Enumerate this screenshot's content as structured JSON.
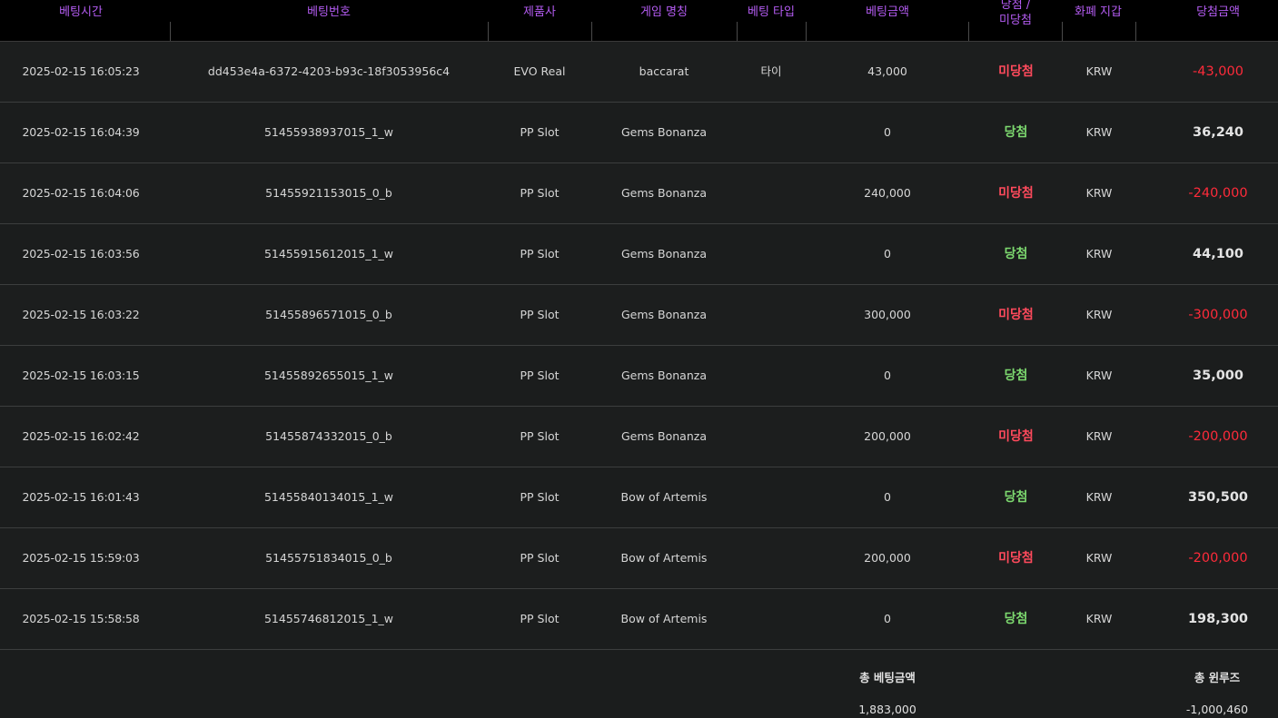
{
  "columns": [
    {
      "key": "time",
      "label": "베팅시간"
    },
    {
      "key": "bet_id",
      "label": "베팅번호"
    },
    {
      "key": "provider",
      "label": "제품사"
    },
    {
      "key": "game",
      "label": "게임 명칭"
    },
    {
      "key": "bet_type",
      "label": "베팅 타입"
    },
    {
      "key": "bet_amount",
      "label": "베팅금액"
    },
    {
      "key": "result",
      "label": "당첨 /\n미당첨"
    },
    {
      "key": "currency",
      "label": "화폐 지갑"
    },
    {
      "key": "win_amount",
      "label": "당첨금액"
    }
  ],
  "rows": [
    {
      "time": "2025-02-15 16:05:23",
      "bet_id": "dd453e4a-6372-4203-b93c-18f3053956c4",
      "provider": "EVO Real",
      "game": "baccarat",
      "bet_type": "타이",
      "bet_amount": "43,000",
      "result": "미당첨",
      "currency": "KRW",
      "win_amount": "-43,000",
      "status": "lose"
    },
    {
      "time": "2025-02-15 16:04:39",
      "bet_id": "51455938937015_1_w",
      "provider": "PP Slot",
      "game": "Gems Bonanza",
      "bet_type": "",
      "bet_amount": "0",
      "result": "당첨",
      "currency": "KRW",
      "win_amount": "36,240",
      "status": "win"
    },
    {
      "time": "2025-02-15 16:04:06",
      "bet_id": "51455921153015_0_b",
      "provider": "PP Slot",
      "game": "Gems Bonanza",
      "bet_type": "",
      "bet_amount": "240,000",
      "result": "미당첨",
      "currency": "KRW",
      "win_amount": "-240,000",
      "status": "lose"
    },
    {
      "time": "2025-02-15 16:03:56",
      "bet_id": "51455915612015_1_w",
      "provider": "PP Slot",
      "game": "Gems Bonanza",
      "bet_type": "",
      "bet_amount": "0",
      "result": "당첨",
      "currency": "KRW",
      "win_amount": "44,100",
      "status": "win"
    },
    {
      "time": "2025-02-15 16:03:22",
      "bet_id": "51455896571015_0_b",
      "provider": "PP Slot",
      "game": "Gems Bonanza",
      "bet_type": "",
      "bet_amount": "300,000",
      "result": "미당첨",
      "currency": "KRW",
      "win_amount": "-300,000",
      "status": "lose"
    },
    {
      "time": "2025-02-15 16:03:15",
      "bet_id": "51455892655015_1_w",
      "provider": "PP Slot",
      "game": "Gems Bonanza",
      "bet_type": "",
      "bet_amount": "0",
      "result": "당첨",
      "currency": "KRW",
      "win_amount": "35,000",
      "status": "win"
    },
    {
      "time": "2025-02-15 16:02:42",
      "bet_id": "51455874332015_0_b",
      "provider": "PP Slot",
      "game": "Gems Bonanza",
      "bet_type": "",
      "bet_amount": "200,000",
      "result": "미당첨",
      "currency": "KRW",
      "win_amount": "-200,000",
      "status": "lose"
    },
    {
      "time": "2025-02-15 16:01:43",
      "bet_id": "51455840134015_1_w",
      "provider": "PP Slot",
      "game": "Bow of Artemis",
      "bet_type": "",
      "bet_amount": "0",
      "result": "당첨",
      "currency": "KRW",
      "win_amount": "350,500",
      "status": "win"
    },
    {
      "time": "2025-02-15 15:59:03",
      "bet_id": "51455751834015_0_b",
      "provider": "PP Slot",
      "game": "Bow of Artemis",
      "bet_type": "",
      "bet_amount": "200,000",
      "result": "미당첨",
      "currency": "KRW",
      "win_amount": "-200,000",
      "status": "lose"
    },
    {
      "time": "2025-02-15 15:58:58",
      "bet_id": "51455746812015_1_w",
      "provider": "PP Slot",
      "game": "Bow of Artemis",
      "bet_type": "",
      "bet_amount": "0",
      "result": "당첨",
      "currency": "KRW",
      "win_amount": "198,300",
      "status": "win"
    }
  ],
  "footer": {
    "total_bet_label": "총 베팅금액",
    "total_bet_value": "1,883,000",
    "total_winloss_label": "총 윈루즈",
    "total_winloss_value": "-1,000,460"
  },
  "colors": {
    "header_text": "#b45cf2",
    "win": "#7dd96f",
    "lose": "#ff4a5c",
    "negative_amount": "#ff2b3a"
  }
}
